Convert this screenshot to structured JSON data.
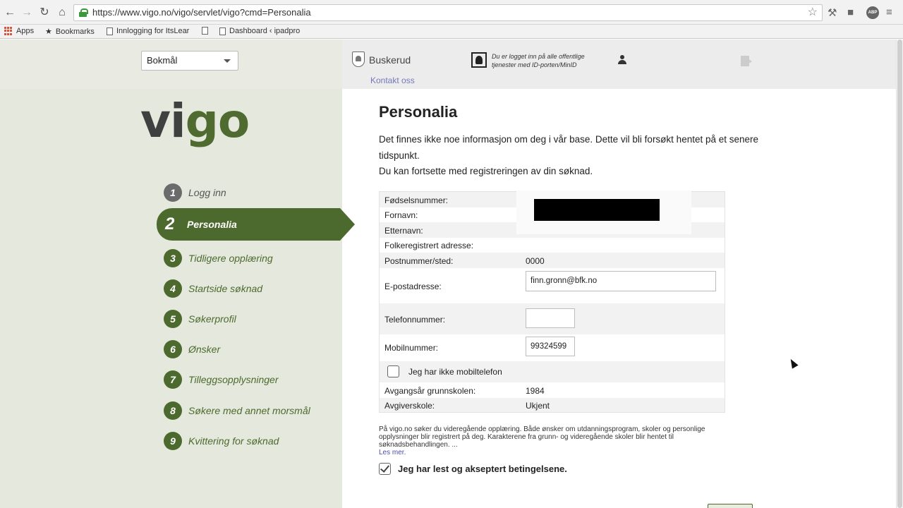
{
  "browser": {
    "url": "https://www.vigo.no/vigo/servlet/vigo?cmd=Personalia",
    "bookmarks": [
      "Apps",
      "Bookmarks",
      "Innlogging for ItsLear",
      "Dashboard ‹ ipadpro"
    ],
    "icons": [
      "back-icon",
      "forward-icon",
      "reload-icon",
      "home-icon",
      "lock-icon",
      "star-icon",
      "wrench-icon",
      "extension-icon",
      "adblock-icon"
    ]
  },
  "header": {
    "language": "Bokmål",
    "county": "Buskerud",
    "contact": "Kontakt oss",
    "login_info": "Du er logget inn på alle offentlige tjenester med ID-porten/MinID"
  },
  "logo": {
    "part1": "vi",
    "part2": "go"
  },
  "steps": [
    {
      "num": "1",
      "label": "Logg inn"
    },
    {
      "num": "2",
      "label": "Personalia"
    },
    {
      "num": "3",
      "label": "Tidligere opplæring"
    },
    {
      "num": "4",
      "label": "Startside søknad"
    },
    {
      "num": "5",
      "label": "Søkerprofil"
    },
    {
      "num": "6",
      "label": "Ønsker"
    },
    {
      "num": "7",
      "label": "Tilleggsopplysninger"
    },
    {
      "num": "8",
      "label": "Søkere med annet morsmål"
    },
    {
      "num": "9",
      "label": "Kvittering for søknad"
    }
  ],
  "main": {
    "title": "Personalia",
    "intro_line1": "Det finnes ikke noe informasjon om deg i vår base. Dette vil bli forsøkt hentet på et senere tidspunkt.",
    "intro_line2": "Du kan fortsette med registreringen av din søknad."
  },
  "form": {
    "fnr_label": "Fødselsnummer:",
    "fornavn_label": "Fornavn:",
    "etternavn_label": "Etternavn:",
    "adresse_label": "Folkeregistrert adresse:",
    "postnr_label": "Postnummer/sted:",
    "postnr_value": "0000",
    "email_label": "E-postadresse:",
    "email_value": "finn.gronn@bfk.no",
    "telefon_label": "Telefonnummer:",
    "telefon_value": "",
    "mobil_label": "Mobilnummer:",
    "mobil_value": "99324599",
    "no_mobile_label": "Jeg har ikke mobiltelefon",
    "avgangsar_label": "Avgangsår grunnskolen:",
    "avgangsar_value": "1984",
    "avgiverskole_label": "Avgiverskole:",
    "avgiverskole_value": "Ukjent"
  },
  "terms": {
    "text": "På vigo.no søker du videregående opplæring. Både ønsker om utdanningsprogram, skoler og personlige opplysninger blir registrert på deg. Karakterene fra grunn- og videregående skoler blir hentet til søknadsbehandlingen. ...",
    "link": "Les mer.",
    "accept": "Jeg har lest og akseptert betingelsene."
  },
  "colors": {
    "accent_green": "#4c6a2d",
    "left_panel": "#e5e8dd",
    "link": "#7478b8"
  }
}
